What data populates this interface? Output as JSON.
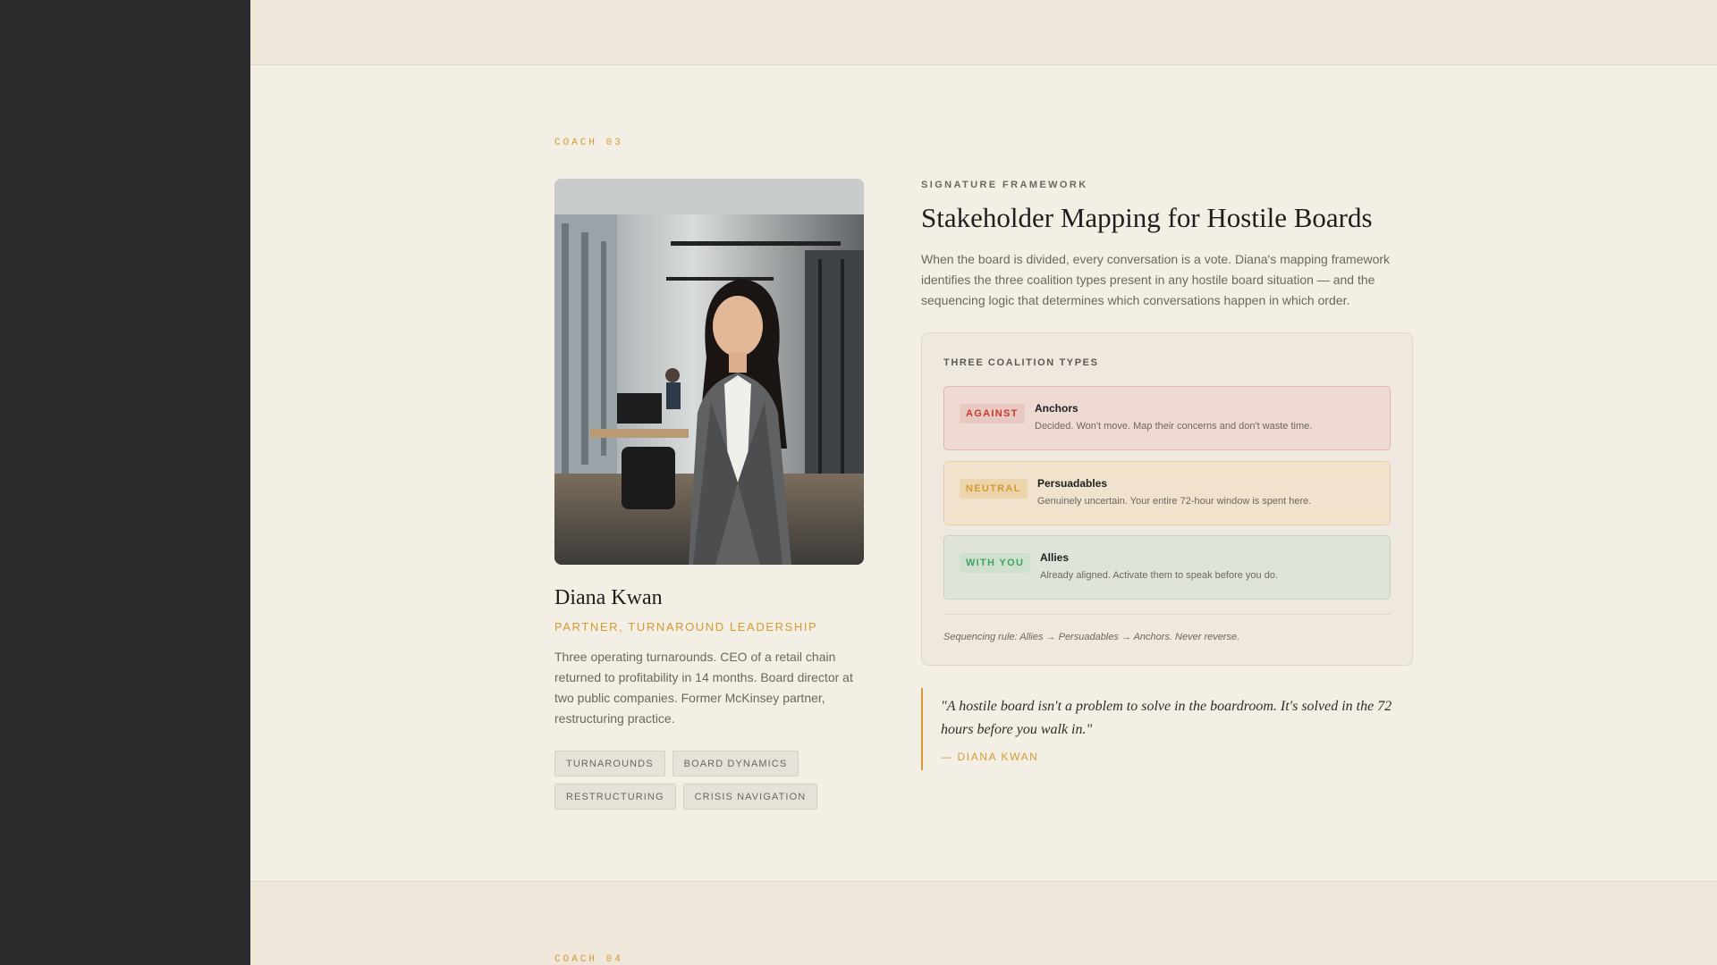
{
  "coach_section": {
    "label": "COACH 03",
    "next_label": "COACH 04"
  },
  "coach": {
    "name": "Diana Kwan",
    "title": "PARTNER, TURNAROUND LEADERSHIP",
    "bio": "Three operating turnarounds. CEO of a retail chain returned to profitability in 14 months. Board director at two public companies. Former McKinsey partner, restructuring practice.",
    "tags": [
      "TURNAROUNDS",
      "BOARD DYNAMICS",
      "RESTRUCTURING",
      "CRISIS NAVIGATION"
    ]
  },
  "framework": {
    "label": "SIGNATURE FRAMEWORK",
    "title": "Stakeholder Mapping for Hostile Boards",
    "description": "When the board is divided, every conversation is a vote. Diana's mapping framework identifies the three coalition types present in any hostile board situation — and the sequencing logic that determines which conversations happen in which order."
  },
  "coalitions": {
    "label": "THREE COALITION TYPES",
    "items": [
      {
        "badge": "AGAINST",
        "name": "Anchors",
        "desc": "Decided. Won't move. Map their concerns and don't waste time."
      },
      {
        "badge": "NEUTRAL",
        "name": "Persuadables",
        "desc": "Genuinely uncertain. Your entire 72-hour window is spent here."
      },
      {
        "badge": "WITH YOU",
        "name": "Allies",
        "desc": "Already aligned. Activate them to speak before you do."
      }
    ],
    "rule": "Sequencing rule: Allies → Persuadables → Anchors. Never reverse."
  },
  "quote": {
    "text": "\"A hostile board isn't a problem to solve in the boardroom. It's solved in the 72 hours before you walk in.\"",
    "author": "— DIANA KWAN"
  },
  "colors": {
    "accent": "#d39a33",
    "against": "#c43a2d",
    "neutral": "#d39a33",
    "with_you": "#3da55d",
    "sidebar": "#2a2b2d",
    "background": "#f4efe5"
  }
}
